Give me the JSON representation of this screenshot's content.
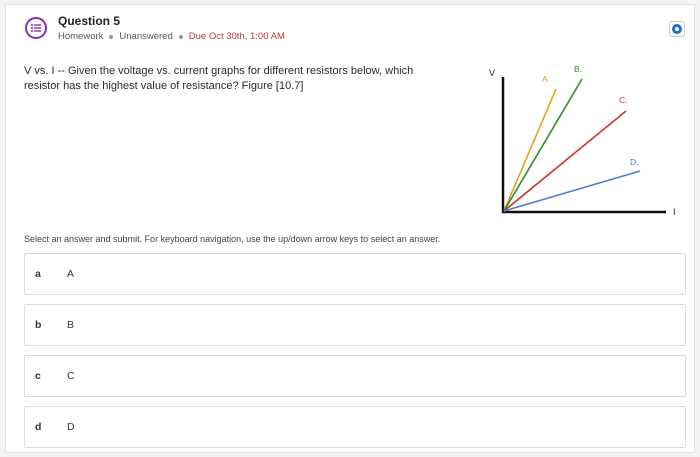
{
  "question": {
    "title": "Question 5",
    "type": "Homework",
    "status": "Unanswered",
    "due": "Due Oct 30th, 1:00 AM",
    "text": "V vs. I -- Given the voltage vs. current graphs for different resistors below, which resistor has the highest value of resistance? Figure [10.7]"
  },
  "figure": {
    "y_axis_label": "V",
    "x_axis_label": "I",
    "lines": [
      {
        "label": "A.",
        "color": "#e3a21a"
      },
      {
        "label": "B.",
        "color": "#2e8b2e"
      },
      {
        "label": "C.",
        "color": "#d0312d"
      },
      {
        "label": "D.",
        "color": "#4a7fd0"
      }
    ]
  },
  "instructions": "Select an answer and submit. For keyboard navigation, use the up/down arrow keys to select an answer.",
  "options": [
    {
      "letter": "a",
      "text": "A"
    },
    {
      "letter": "b",
      "text": "B"
    },
    {
      "letter": "c",
      "text": "C"
    },
    {
      "letter": "d",
      "text": "D"
    }
  ],
  "icons": {
    "question": "question-list-icon",
    "flag": "bookmark-flag-icon"
  },
  "colors": {
    "icon_purple": "#8a2bb3",
    "due_red": "#c0392b",
    "flag_blue": "#1a73c9"
  }
}
